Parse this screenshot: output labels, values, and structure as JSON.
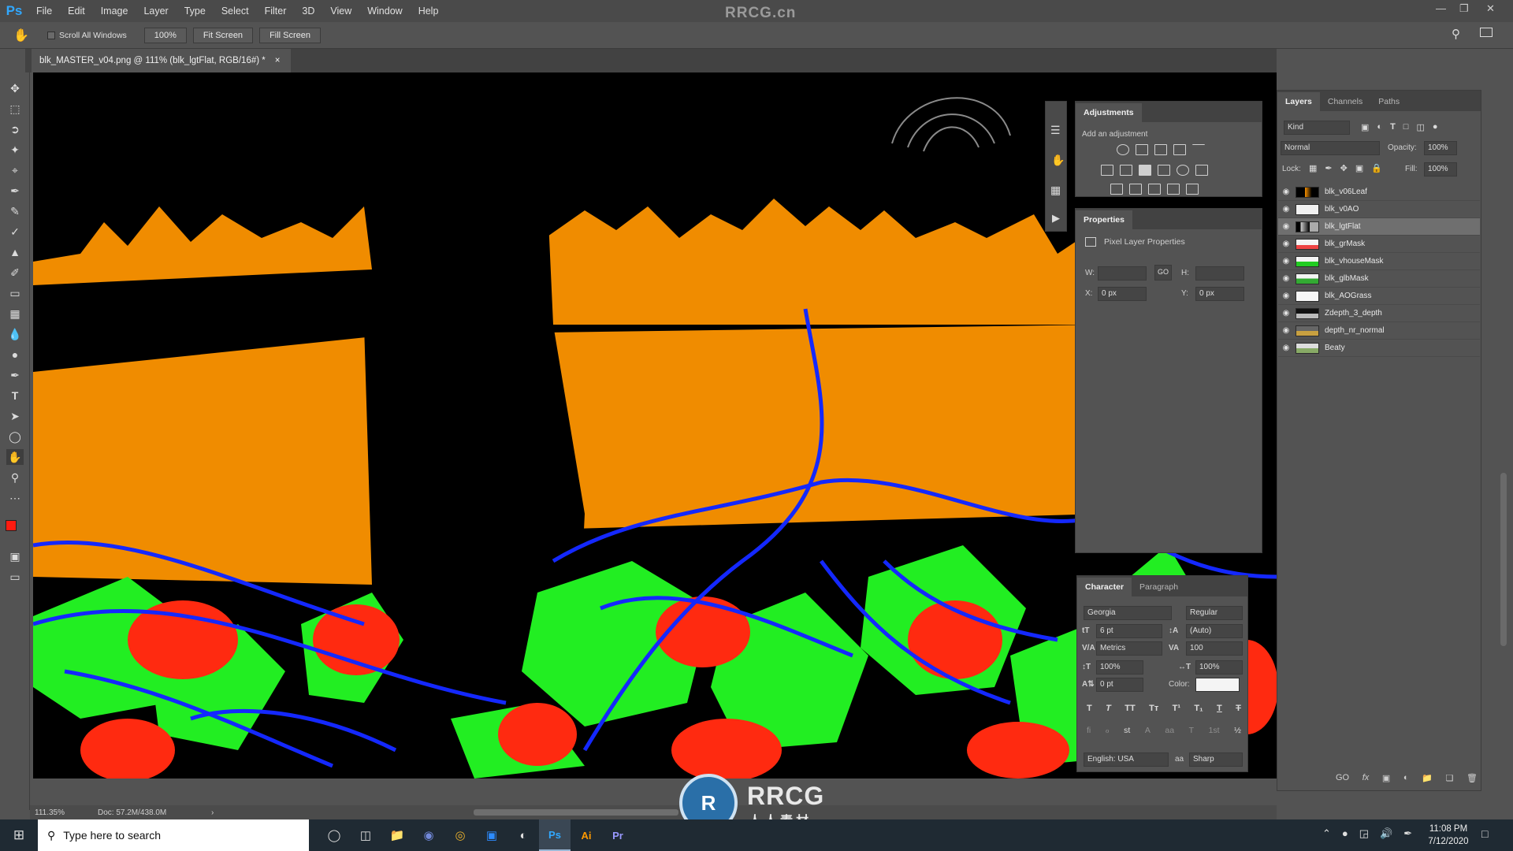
{
  "app": {
    "logo": "Ps",
    "menu": [
      "File",
      "Edit",
      "Image",
      "Layer",
      "Type",
      "Select",
      "Filter",
      "3D",
      "View",
      "Window",
      "Help"
    ],
    "watermark": "RRCG.cn"
  },
  "options_bar": {
    "scroll_all_windows": "Scroll All Windows",
    "zoom": "100%",
    "fit_screen": "Fit Screen",
    "fill_screen": "Fill Screen"
  },
  "document": {
    "tab_title": "blk_MASTER_v04.png @ 111% (blk_lgtFlat, RGB/16#) *",
    "close": "×"
  },
  "status": {
    "zoom": "111.35%",
    "doc": "Doc: 57.2M/438.0M"
  },
  "adjustments": {
    "title": "Adjustments",
    "subtitle": "Add an adjustment"
  },
  "properties": {
    "title": "Properties",
    "subtitle": "Pixel Layer Properties",
    "w_label": "W:",
    "h_label": "H:",
    "x_label": "X:",
    "y_label": "Y:",
    "x_value": "0 px",
    "y_value": "0 px",
    "link_icon": "GO"
  },
  "character": {
    "tabs": [
      "Character",
      "Paragraph"
    ],
    "font_family": "Georgia",
    "font_style": "Regular",
    "size": "6 pt",
    "leading": "(Auto)",
    "kerning": "Metrics",
    "tracking": "100",
    "vscale": "100%",
    "hscale": "100%",
    "baseline": "0 pt",
    "color_label": "Color:",
    "style_buttons": [
      "T",
      "T",
      "TT",
      "Tт",
      "T¹",
      "T₁",
      "T",
      "T"
    ],
    "opentype_buttons": [
      "fi",
      "ℴ",
      "st",
      "A",
      "aa",
      "T",
      "1st",
      "½"
    ],
    "language": "English: USA",
    "aa_label": "aa",
    "antialias": "Sharp"
  },
  "layers_panel": {
    "tabs": [
      "Layers",
      "Channels",
      "Paths"
    ],
    "kind": "Kind",
    "blend_mode": "Normal",
    "opacity_label": "Opacity:",
    "opacity": "100%",
    "lock_label": "Lock:",
    "fill_label": "Fill:",
    "fill": "100%",
    "footer_icons": [
      "GO",
      "fx"
    ],
    "layers": [
      {
        "name": "blk_v06Leaf"
      },
      {
        "name": "blk_v0AO"
      },
      {
        "name": "blk_lgtFlat"
      },
      {
        "name": "blk_grMask"
      },
      {
        "name": "blk_vhouseMask"
      },
      {
        "name": "blk_glbMask"
      },
      {
        "name": "blk_AOGrass"
      },
      {
        "name": "Zdepth_3_depth"
      },
      {
        "name": "depth_nr_normal"
      },
      {
        "name": "Beaty"
      }
    ]
  },
  "watermark_bottom": {
    "brand": "RRCG",
    "cn": "人人素材"
  },
  "taskbar": {
    "search_placeholder": "Type here to search",
    "apps": [
      "Ai",
      "Pr"
    ],
    "time": "11:08 PM",
    "date": "7/12/2020"
  },
  "colors": {
    "orange": "#f08c00",
    "green": "#22ee22",
    "red": "#ff2a10",
    "blue": "#1428ff",
    "ps_blue": "#31a8ff"
  }
}
